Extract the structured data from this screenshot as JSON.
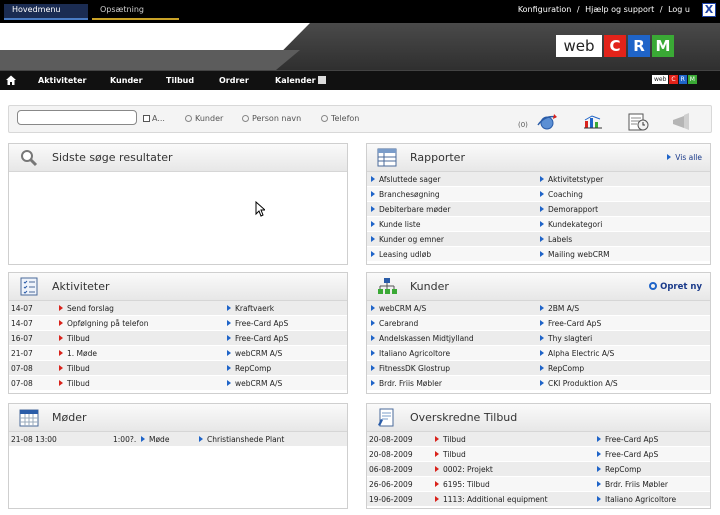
{
  "top_tabs": {
    "main": "Hovedmenu",
    "setup": "Opsætning"
  },
  "top_links": {
    "config": "Konfiguration",
    "sep1": "/",
    "help": "Hjælp og support",
    "sep2": "/",
    "logout": "Log u"
  },
  "close_label": "X",
  "logo": {
    "web": "web",
    "c": "C",
    "r": "R",
    "m": "M"
  },
  "nav": {
    "items": [
      "Aktiviteter",
      "Kunder",
      "Tilbud",
      "Ordrer",
      "Kalender"
    ]
  },
  "search": {
    "value": "",
    "checkbox_label": "A...",
    "options": [
      "Kunder",
      "Person navn",
      "Telefon"
    ],
    "count": "(0)"
  },
  "panels": {
    "search_results": {
      "title": "Sidste søge resultater"
    },
    "reports": {
      "title": "Rapporter",
      "link": "Vis alle",
      "left": [
        "Afsluttede sager",
        "Branchesøgning",
        "Debiterbare møder",
        "Kunde liste",
        "Kunder og emner",
        "Leasing udløb"
      ],
      "right": [
        "Aktivitetstyper",
        "Coaching",
        "Demorapport",
        "Kundekategori",
        "Labels",
        "Mailing webCRM"
      ]
    },
    "activities": {
      "title": "Aktiviteter",
      "rows": [
        {
          "date": "14-07",
          "activity": "Send forslag",
          "company": "Kraftvaerk"
        },
        {
          "date": "14-07",
          "activity": "Opfølgning på telefon",
          "company": "Free-Card ApS"
        },
        {
          "date": "16-07",
          "activity": "Tilbud",
          "company": "Free-Card ApS"
        },
        {
          "date": "21-07",
          "activity": "1. Møde",
          "company": "webCRM A/S"
        },
        {
          "date": "07-08",
          "activity": "Tilbud",
          "company": "RepComp"
        },
        {
          "date": "07-08",
          "activity": "Tilbud",
          "company": "webCRM A/S"
        }
      ]
    },
    "customers": {
      "title": "Kunder",
      "link": "Opret ny",
      "left": [
        "webCRM A/S",
        "Carebrand",
        "Andelskassen Midtjylland",
        "Italiano Agricoltore",
        "FitnessDK Glostrup",
        "Brdr. Friis Møbler"
      ],
      "right": [
        "2BM A/S",
        "Free-Card ApS",
        "Thy slagteri",
        "Alpha Electric A/S",
        "RepComp",
        "CKI Produktion A/S"
      ]
    },
    "meetings": {
      "title": "Møder",
      "rows": [
        {
          "date": "21-08 13:00",
          "time": "1:00?.",
          "type": "Møde",
          "place": "Christianshede Plant"
        }
      ]
    },
    "overdue_offers": {
      "title": "Overskredne Tilbud",
      "rows": [
        {
          "date": "20-08-2009",
          "offer": "Tilbud",
          "company": "Free-Card ApS"
        },
        {
          "date": "20-08-2009",
          "offer": "Tilbud",
          "company": "Free-Card ApS"
        },
        {
          "date": "06-08-2009",
          "offer": "0002: Projekt",
          "company": "RepComp"
        },
        {
          "date": "26-06-2009",
          "offer": "6195: Tilbud",
          "company": "Brdr. Friis Møbler"
        },
        {
          "date": "19-06-2009",
          "offer": "1113: Additional equipment",
          "company": "Italiano Agricoltore"
        }
      ]
    }
  },
  "colors": {
    "accent_blue": "#1f64c8",
    "accent_red": "#e2231a",
    "accent_green": "#3aa935",
    "nav_bg": "#111111"
  }
}
